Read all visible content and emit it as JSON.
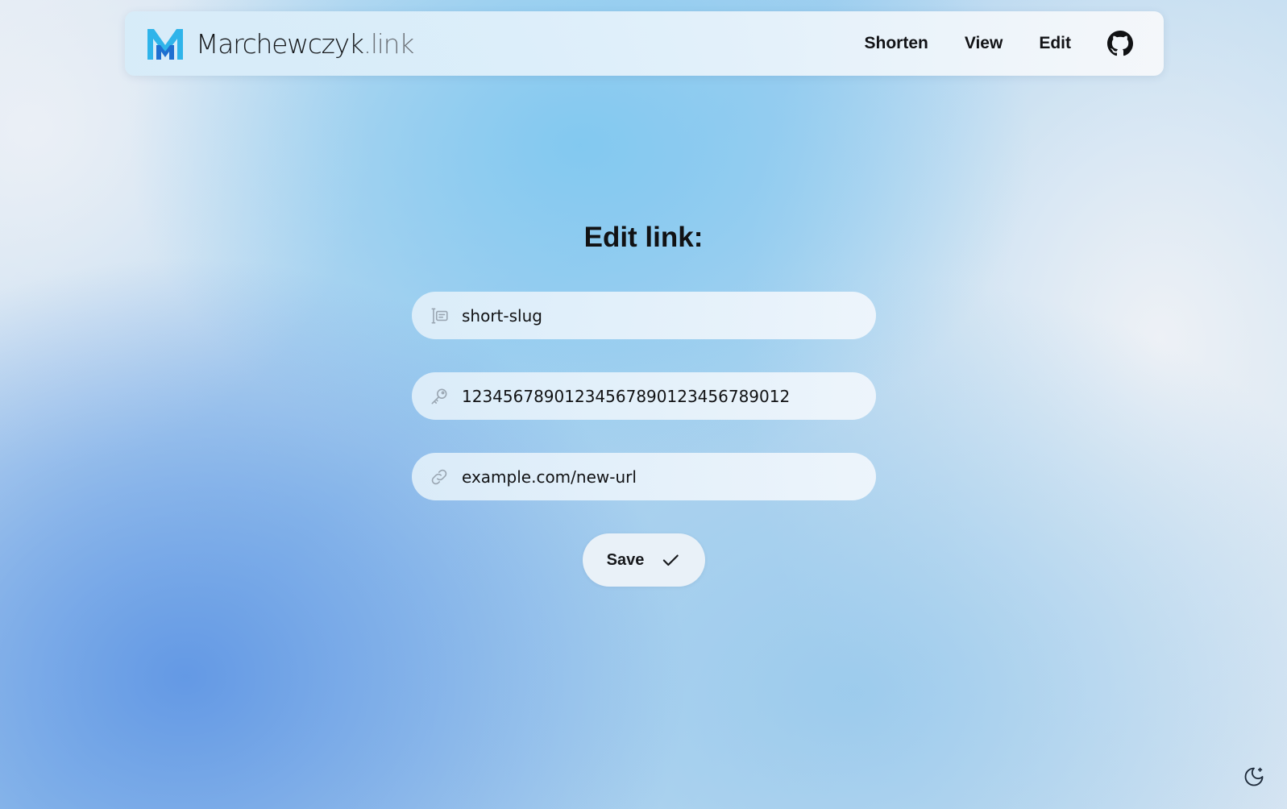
{
  "brand": {
    "name": "Marchewczyk",
    "tld": ".link",
    "logo_icon": "marchewczyk-m-logo",
    "colors": {
      "logo_light": "#2fb4ea",
      "logo_dark": "#1f6fd0"
    }
  },
  "nav": {
    "items": [
      {
        "label": "Shorten"
      },
      {
        "label": "View"
      },
      {
        "label": "Edit"
      }
    ],
    "github_icon": "github-icon"
  },
  "main": {
    "title": "Edit link:",
    "fields": {
      "slug": {
        "value": "short-slug",
        "icon": "text-cursor-icon"
      },
      "key": {
        "value": "12345678901234567890123456789012",
        "icon": "key-icon"
      },
      "url": {
        "value": "example.com/new-url",
        "icon": "link-icon"
      }
    },
    "save_button": {
      "label": "Save",
      "icon": "check-icon"
    }
  },
  "theme_toggle": {
    "icon": "moon-icon"
  }
}
